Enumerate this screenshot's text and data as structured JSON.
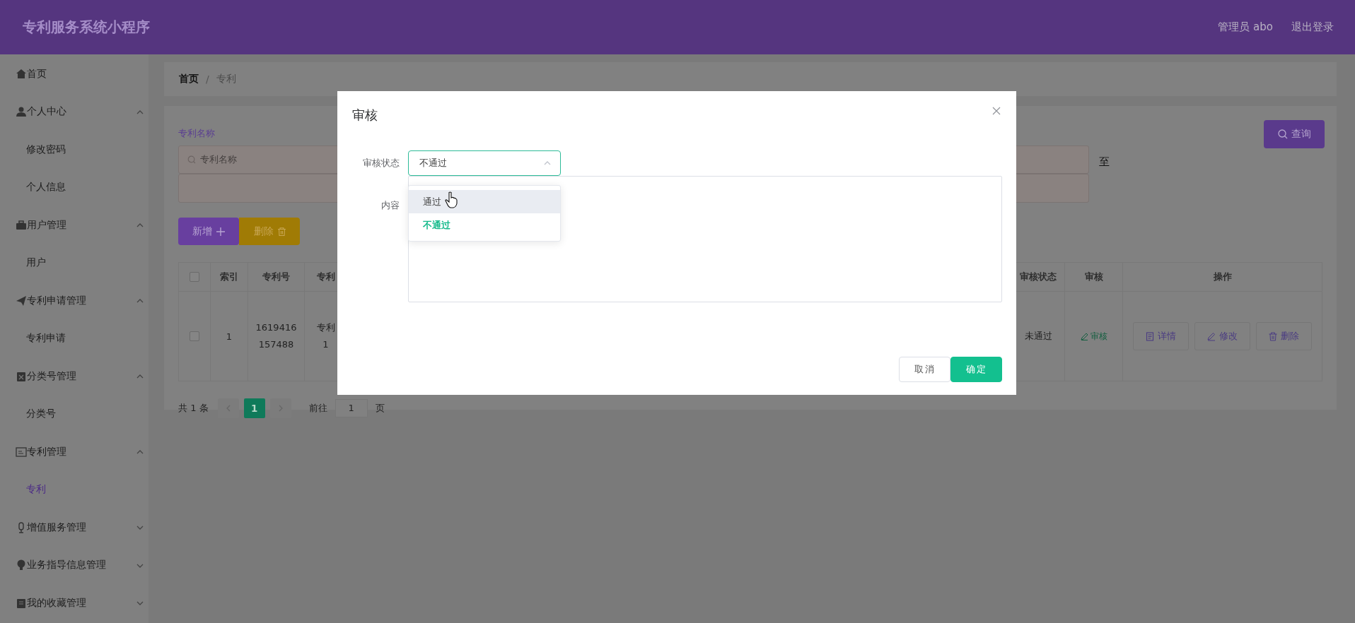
{
  "header": {
    "title": "专利服务系统小程序",
    "user": "管理员 abo",
    "logout": "退出登录"
  },
  "sidebar": {
    "items": [
      {
        "label": "首页",
        "selected": false
      },
      {
        "label": "个人中心",
        "expanded": true,
        "children": [
          {
            "label": "修改密码",
            "selected": false
          },
          {
            "label": "个人信息",
            "selected": false
          }
        ]
      },
      {
        "label": "用户管理",
        "expanded": true,
        "children": [
          {
            "label": "用户",
            "selected": false
          }
        ]
      },
      {
        "label": "专利申请管理",
        "expanded": true,
        "children": [
          {
            "label": "专利申请",
            "selected": false
          }
        ]
      },
      {
        "label": "分类号管理",
        "expanded": true,
        "children": [
          {
            "label": "分类号",
            "selected": false
          }
        ]
      },
      {
        "label": "专利管理",
        "expanded": true,
        "children": [
          {
            "label": "专利",
            "selected": true
          }
        ]
      },
      {
        "label": "增值服务管理",
        "expanded": false
      },
      {
        "label": "业务指导信息管理",
        "expanded": false
      },
      {
        "label": "我的收藏管理",
        "expanded": false
      }
    ]
  },
  "breadcrumb": {
    "items": [
      "首页",
      "专利"
    ],
    "separator": "/"
  },
  "search": {
    "label": "专利名称",
    "placeholder": "专利名称",
    "range_separator": "至",
    "button": "查询"
  },
  "actions": [
    {
      "label": "新增",
      "kind": "add"
    },
    {
      "label": "删除",
      "kind": "delete"
    }
  ],
  "table": {
    "header_checked": false,
    "columns": [
      "索引",
      "专利号",
      "专利",
      "审核状态",
      "审核",
      "操作"
    ],
    "rows": [
      {
        "checked": false,
        "cells": [
          "1",
          "1619416157488",
          "专利1",
          "未通过"
        ],
        "review": "审核",
        "operations": [
          {
            "label": "详情",
            "kind": "detail"
          },
          {
            "label": "修改",
            "kind": "edit"
          },
          {
            "label": "删除",
            "kind": "delete"
          }
        ]
      }
    ]
  },
  "pagination": {
    "total": "共 1 条",
    "pages": [
      {
        "label": "1",
        "selected": true
      }
    ],
    "goto": "前往",
    "page_input": "1",
    "page_suffix": "页"
  },
  "dialog": {
    "title": "审核",
    "fields": [
      {
        "kind": "select",
        "label": "审核状态",
        "value": "不通过",
        "open": true,
        "options": [
          {
            "label": "通过",
            "selected": false,
            "hovered": true
          },
          {
            "label": "不通过",
            "selected": true,
            "hovered": false
          }
        ]
      },
      {
        "kind": "textarea",
        "label": "内容"
      }
    ],
    "buttons": [
      {
        "label": "取消",
        "kind": "default"
      },
      {
        "label": "确定",
        "kind": "primary"
      }
    ]
  }
}
